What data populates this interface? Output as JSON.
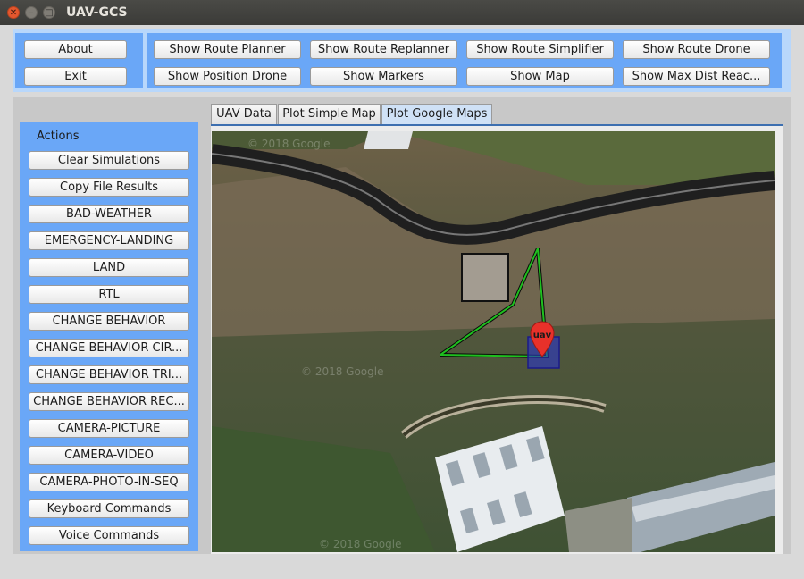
{
  "window": {
    "title": "UAV-GCS",
    "controls": [
      "close-icon",
      "minimize-icon",
      "maximize-icon"
    ]
  },
  "top_left_buttons": {
    "about": "About",
    "exit": "Exit"
  },
  "top_buttons": {
    "route_planner": "Show Route Planner",
    "route_replanner": "Show Route Replanner",
    "route_simplifier": "Show Route Simplifier",
    "route_drone": "Show Route Drone",
    "position_drone": "Show Position Drone",
    "markers": "Show Markers",
    "map": "Show Map",
    "max_dist": "Show Max Dist Reac..."
  },
  "tabs": [
    {
      "label": "UAV Data",
      "active": false
    },
    {
      "label": "Plot Simple Map",
      "active": false
    },
    {
      "label": "Plot Google Maps",
      "active": true
    }
  ],
  "actions": {
    "title": "Actions",
    "items": [
      "Clear Simulations",
      "Copy File Results",
      "BAD-WEATHER",
      "EMERGENCY-LANDING",
      "LAND",
      "RTL",
      "CHANGE BEHAVIOR",
      "CHANGE BEHAVIOR CIR...",
      "CHANGE BEHAVIOR TRI...",
      "CHANGE BEHAVIOR REC...",
      "CAMERA-PICTURE",
      "CAMERA-VIDEO",
      "CAMERA-PHOTO-IN-SEQ",
      "Keyboard Commands",
      "Voice Commands"
    ]
  },
  "map": {
    "marker_label": "uav",
    "watermark": "© 2018 Google",
    "route_color": "#1fbf1f",
    "marker_color": "#e8312a",
    "drone_box_color": "#2a35c8"
  },
  "colors": {
    "panel_blue": "#6aa7f7",
    "panel_light": "#b8d7fb"
  }
}
